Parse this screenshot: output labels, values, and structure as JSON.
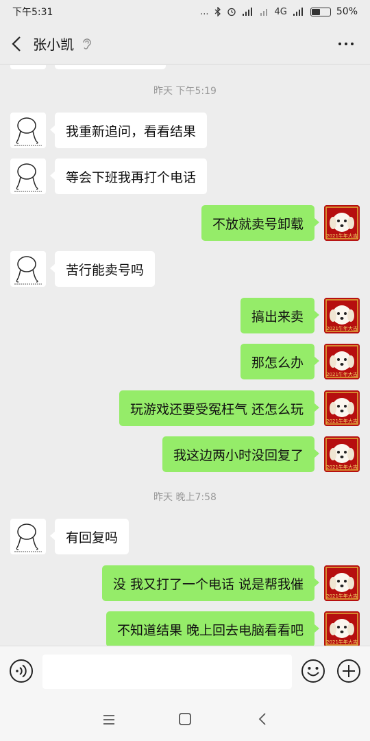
{
  "status_bar": {
    "time": "下午5:31",
    "indicators": "...",
    "network": "4G",
    "battery_text": "50%",
    "battery_level": 0.5
  },
  "header": {
    "title": "张小凯"
  },
  "input": {
    "value": "",
    "placeholder": ""
  },
  "chat": {
    "timestamps": [
      "昨天 下午5:19",
      "昨天 晚上7:58"
    ],
    "messages": [
      {
        "side": "left",
        "text": "我重新追问，看看结果"
      },
      {
        "side": "left",
        "text": "等会下班我再打个电话"
      },
      {
        "side": "right",
        "text": "不放就卖号卸载"
      },
      {
        "side": "left",
        "text": "苦行能卖号吗"
      },
      {
        "side": "right",
        "text": "搞出来卖"
      },
      {
        "side": "right",
        "text": "那怎么办"
      },
      {
        "side": "right",
        "text": "玩游戏还要受冤枉气 还怎么玩"
      },
      {
        "side": "right",
        "text": "我这边两小时没回复了"
      },
      {
        "side": "left",
        "text": "有回复吗"
      },
      {
        "side": "right",
        "text": "没 我又打了一个电话 说是帮我催"
      },
      {
        "side": "right",
        "text": "不知道结果 晚上回去电脑看看吧"
      }
    ]
  },
  "avatars": {
    "right_badge": "2021牛年大吉"
  },
  "colors": {
    "background": "#ededed",
    "bubble_self": "#95ec69",
    "bubble_other": "#ffffff",
    "avatar_self_bg": "#b60f0f"
  }
}
